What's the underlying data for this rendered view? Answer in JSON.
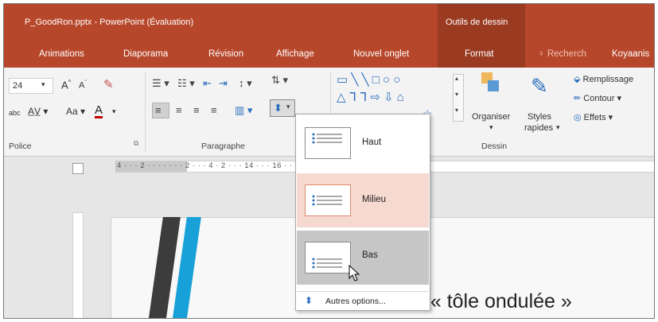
{
  "window": {
    "title": "P_GoodRon.pptx - PowerPoint (Évaluation)",
    "context_header": "Outils de dessin"
  },
  "tabs": [
    {
      "label": "Animations"
    },
    {
      "label": "Diaporama"
    },
    {
      "label": "Révision"
    },
    {
      "label": "Affichage"
    },
    {
      "label": "Nouvel onglet"
    },
    {
      "label": "Format"
    },
    {
      "label": "Recherch"
    },
    {
      "label": "Koyaanis"
    }
  ],
  "ribbon": {
    "font_size": "24",
    "font_group_label": "Police",
    "paragraph_group_label": "Paragraphe",
    "drawing_group_label": "Dessin",
    "organize_label": "Organiser",
    "styles_label_1": "Styles",
    "styles_label_2": "rapides",
    "fill_label": "Remplissage",
    "outline_label": "Contour",
    "effects_label": "Effets",
    "aa_label": "Aa",
    "abc_label": "abc"
  },
  "ruler": {
    "ticks": "4 · · · 2 · · · · · · · 2 · · · 4 ·                                                                2 · · · 14 · · · 16 · · · 18 · · · 20 · · · 22 ·"
  },
  "dropdown": {
    "options": [
      {
        "label": "Haut",
        "state": "normal"
      },
      {
        "label": "Milieu",
        "state": "hover"
      },
      {
        "label": "Bas",
        "state": "pressed"
      }
    ],
    "more_label": "Autres options..."
  },
  "slide": {
    "visible_text": "e « tôle ondulée »"
  },
  "colors": {
    "accent": "#b7472a",
    "context": "#9a3a20",
    "hover": "#f6d9cf",
    "blue_stripe": "#18a0d8"
  }
}
